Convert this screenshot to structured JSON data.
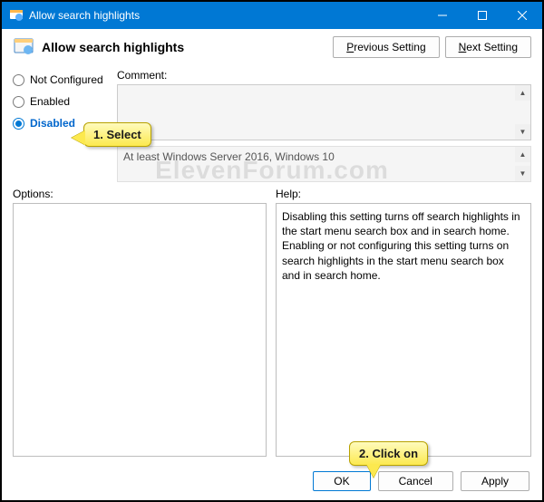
{
  "title": "Allow search highlights",
  "header": "Allow search highlights",
  "nav": {
    "prev_p": "P",
    "prev_rest": "revious Setting",
    "next_n": "N",
    "next_rest": "ext Setting"
  },
  "radios": {
    "not_configured": "Not Configured",
    "enabled": "Enabled",
    "disabled": "Disabled"
  },
  "comment_label": "Comment:",
  "supported_text": "At least Windows Server 2016, Windows 10",
  "options_label": "Options:",
  "help_label": "Help:",
  "help_text": "Disabling this setting turns off search highlights in the start menu search box and in search home. Enabling or not configuring this setting turns on search highlights in the start menu search box and in search home.",
  "buttons": {
    "ok": "OK",
    "cancel": "Cancel",
    "apply": "Apply"
  },
  "callouts": {
    "select": "1. Select",
    "click": "2. Click on"
  },
  "watermark": "ElevenForum.com"
}
